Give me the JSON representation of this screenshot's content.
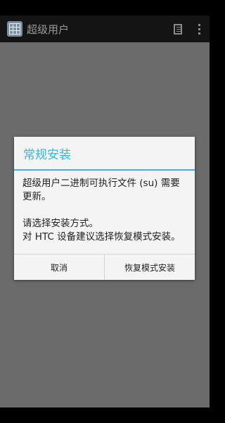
{
  "app": {
    "title": "超级用户",
    "icons": {
      "app": "grid-app-icon",
      "log": "document-icon",
      "menu": "overflow-menu-icon"
    }
  },
  "dialog": {
    "title": "常规安装",
    "message_line1": "超级用户二进制可执行文件 (su) 需要更新。",
    "message_line2": "请选择安装方式。\n对 HTC 设备建议选择恢复模式安装。",
    "cancel_label": "取消",
    "recovery_label": "恢复模式安装"
  },
  "colors": {
    "accent": "#33b5e5",
    "dim_background": "#6b6b6b",
    "dialog_background": "#f4f4f4"
  }
}
